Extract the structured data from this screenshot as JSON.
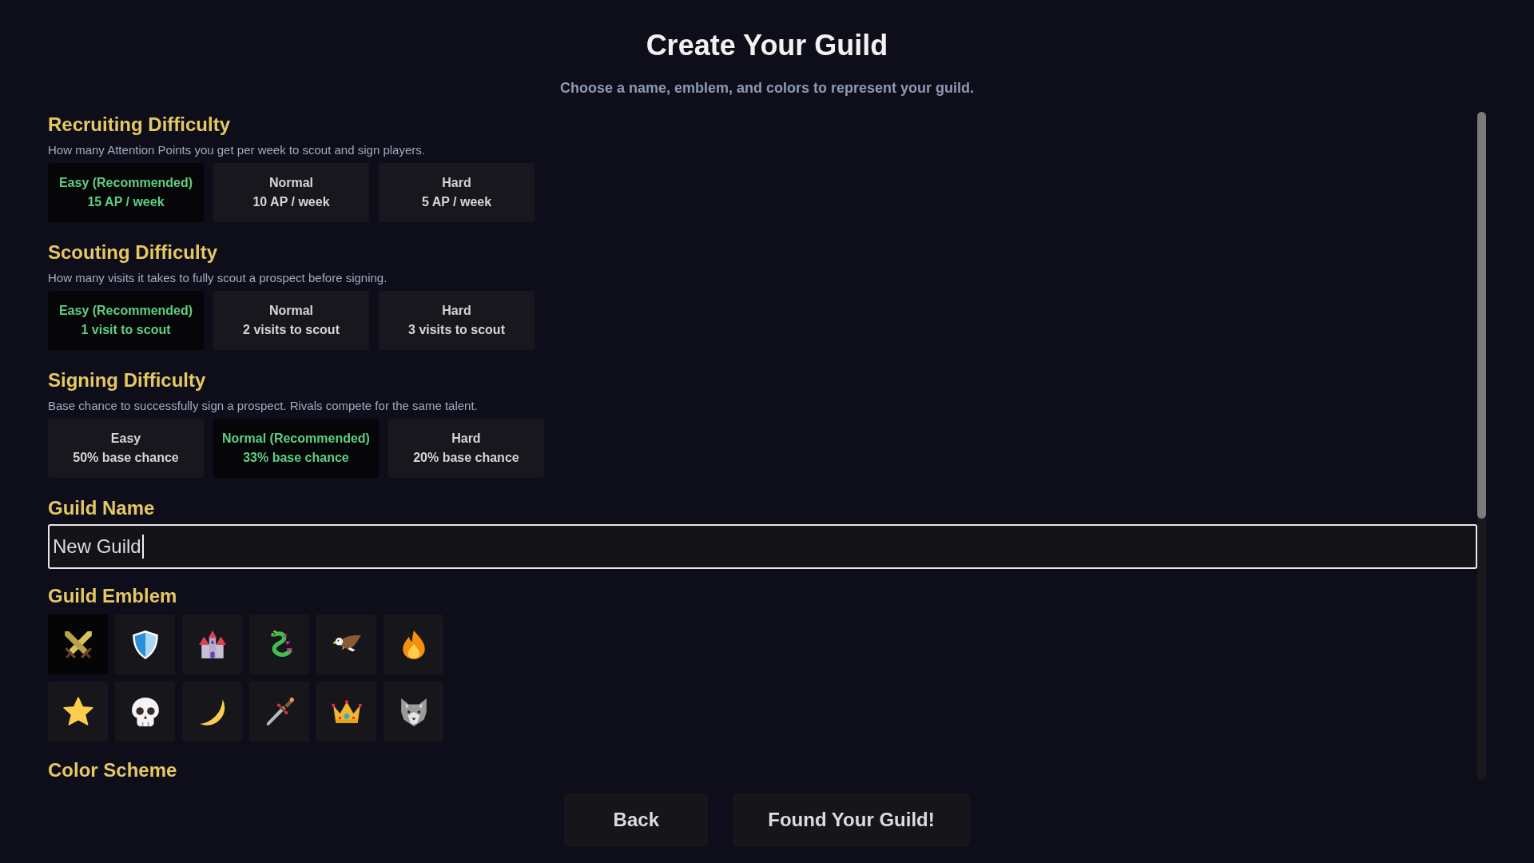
{
  "title": "Create Your Guild",
  "subtitle": "Choose a name, emblem, and colors to represent your guild.",
  "sections": [
    {
      "title": "Recruiting Difficulty",
      "description": "How many Attention Points you get per week to scout and sign players.",
      "options": [
        {
          "label": "Easy (Recommended)",
          "detail": "15 AP / week",
          "selected": true
        },
        {
          "label": "Normal",
          "detail": "10 AP / week",
          "selected": false
        },
        {
          "label": "Hard",
          "detail": "5 AP / week",
          "selected": false
        }
      ]
    },
    {
      "title": "Scouting Difficulty",
      "description": "How many visits it takes to fully scout a prospect before signing.",
      "options": [
        {
          "label": "Easy (Recommended)",
          "detail": "1 visit to scout",
          "selected": true
        },
        {
          "label": "Normal",
          "detail": "2 visits to scout",
          "selected": false
        },
        {
          "label": "Hard",
          "detail": "3 visits to scout",
          "selected": false
        }
      ]
    },
    {
      "title": "Signing Difficulty",
      "description": "Base chance to successfully sign a prospect. Rivals compete for the same talent.",
      "options": [
        {
          "label": "Easy",
          "detail": "50% base chance",
          "selected": false
        },
        {
          "label": "Normal (Recommended)",
          "detail": "33% base chance",
          "selected": true
        },
        {
          "label": "Hard",
          "detail": "20% base chance",
          "selected": false
        }
      ]
    }
  ],
  "guild_name": {
    "label": "Guild Name",
    "value": "New Guild",
    "focused": true
  },
  "guild_emblem": {
    "label": "Guild Emblem",
    "emblems": [
      {
        "selected": true
      },
      {
        "selected": false
      },
      {
        "selected": false
      },
      {
        "selected": false
      },
      {
        "selected": false
      },
      {
        "selected": false
      },
      {
        "selected": false
      },
      {
        "selected": false
      },
      {
        "selected": false
      },
      {
        "selected": false
      },
      {
        "selected": false
      },
      {
        "selected": false
      }
    ]
  },
  "color_scheme": {
    "label": "Color Scheme"
  },
  "buttons": [
    {
      "label": "Back"
    },
    {
      "label": "Found Your Guild!"
    }
  ]
}
